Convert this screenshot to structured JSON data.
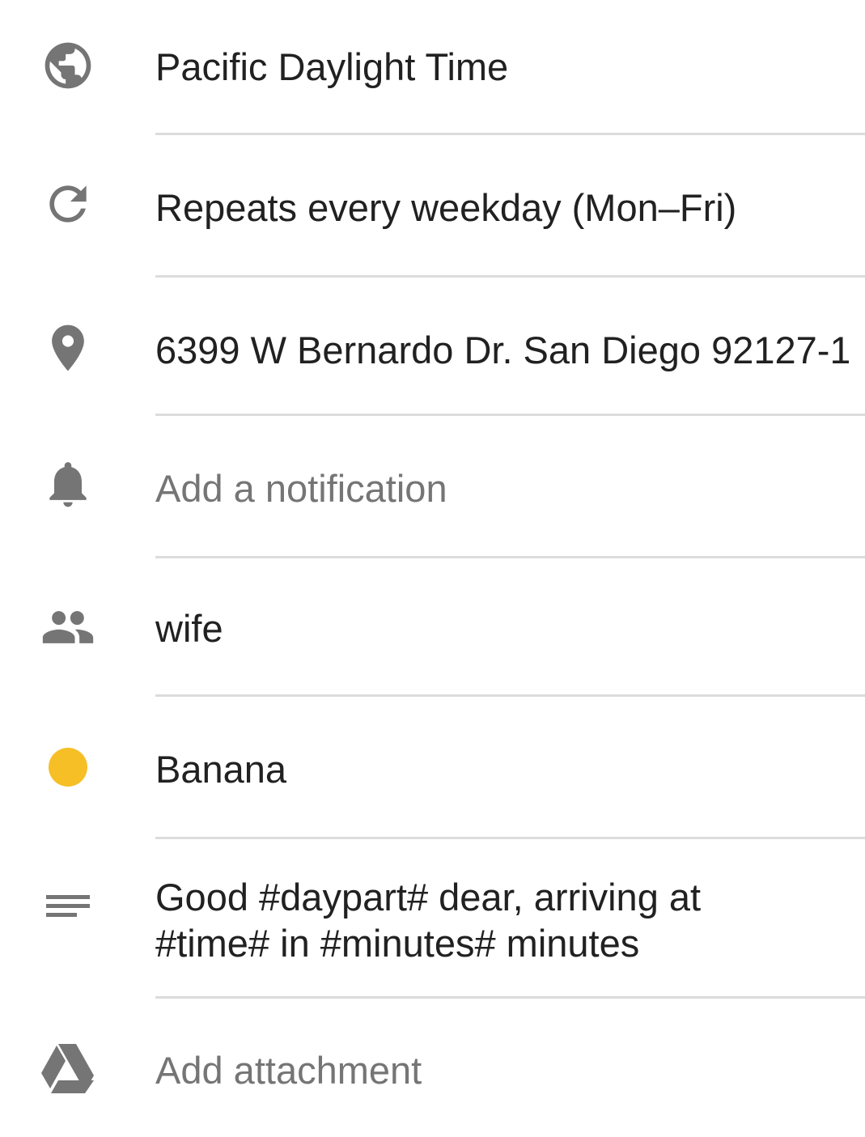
{
  "event_details": {
    "timezone": {
      "icon": "globe-icon",
      "label": "Pacific Daylight Time"
    },
    "repeat": {
      "icon": "repeat-icon",
      "label": "Repeats every weekday (Mon–Fri)"
    },
    "location": {
      "icon": "location-pin-icon",
      "label": "6399 W Bernardo Dr. San Diego 92127-1"
    },
    "notification": {
      "icon": "bell-icon",
      "label": "Add a notification"
    },
    "guests": {
      "icon": "people-icon",
      "label": "wife"
    },
    "color": {
      "icon": "color-dot-icon",
      "label": "Banana",
      "swatch": "#F6BF26"
    },
    "description": {
      "icon": "notes-icon",
      "label": "Good #daypart# dear, arriving at #time# in #minutes# minutes"
    },
    "attachment": {
      "icon": "drive-icon",
      "label": "Add attachment"
    }
  },
  "colors": {
    "icon": "#757575",
    "text": "#212121",
    "placeholder": "#757575",
    "divider": "#DCDCDC"
  }
}
